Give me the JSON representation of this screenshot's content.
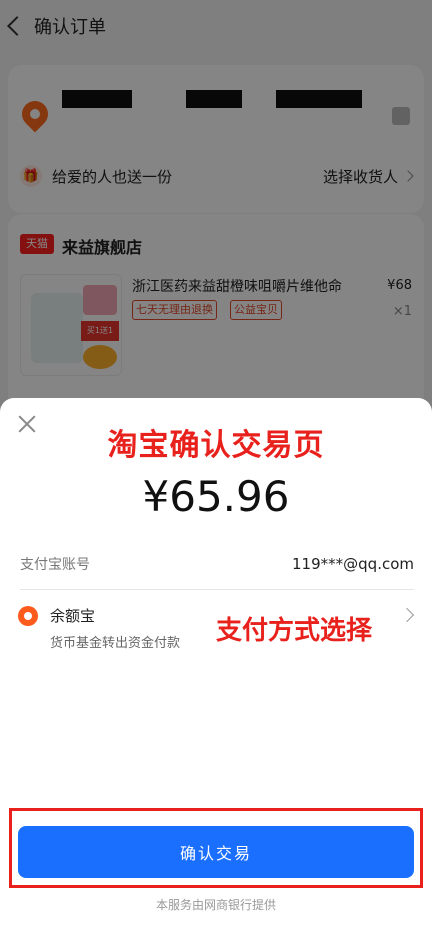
{
  "header": {
    "title": "确认订单"
  },
  "address_card": {
    "gift_text": "给爱的人也送一份",
    "choose_receiver": "选择收货人"
  },
  "shop": {
    "badge": "天猫",
    "name": "来益旗舰店",
    "product": {
      "title": "浙江医药来益甜橙味咀嚼片维他命",
      "price": "¥68",
      "qty": "×1",
      "tags": [
        "七天无理由退换",
        "公益宝贝"
      ],
      "image_text": "买1送1"
    }
  },
  "sheet": {
    "overlay_title": "淘宝确认交易页",
    "amount": "¥65.96",
    "account_label": "支付宝账号",
    "account_value": "119***@qq.com",
    "pay_method_name": "余额宝",
    "pay_method_sub": "货币基金转出资金付款",
    "pay_method_annotation": "支付方式选择",
    "confirm_label": "确认交易",
    "footer_note": "本服务由网商银行提供"
  },
  "colors": {
    "accent_blue": "#1b6fff",
    "annotation_red": "#e8211c",
    "brand_orange": "#ff5b1c"
  }
}
